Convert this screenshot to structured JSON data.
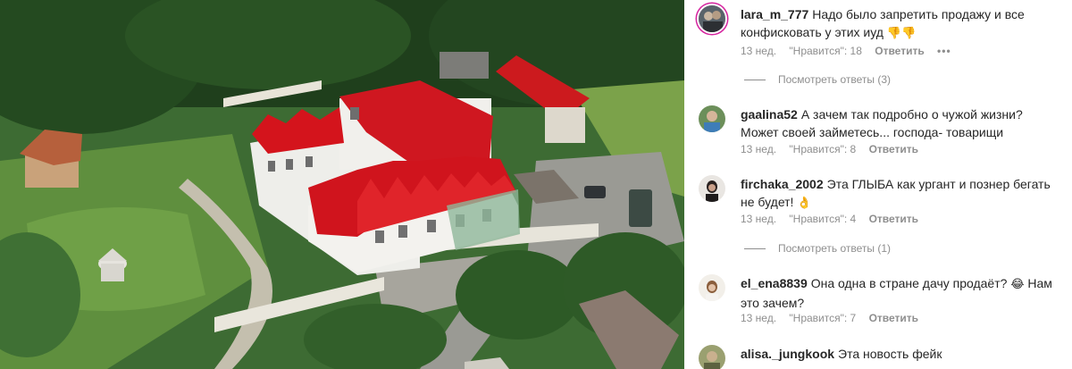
{
  "comments": [
    {
      "username": "lara_m_777",
      "text": "Надо было запретить продажу и все конфисковать у этих иуд",
      "emoji": "👎👎",
      "time": "13 нед.",
      "likes": "\"Нравится\": 18",
      "reply": "Ответить",
      "more": "•••",
      "view_replies": "Посмотреть ответы (3)",
      "avatar_icon": "user-avatar-icon"
    },
    {
      "username": "gaalina52",
      "text": "А зачем так подробно о чужой жизни? Может своей займетесь... господа- товарищи",
      "time": "13 нед.",
      "likes": "\"Нравится\": 8",
      "reply": "Ответить",
      "avatar_icon": "user-avatar-icon"
    },
    {
      "username": "firchaka_2002",
      "text": "Эта ГЛЫБА как ургант и познер бегать не будет!",
      "emoji": "👌",
      "time": "13 нед.",
      "likes": "\"Нравится\": 4",
      "reply": "Ответить",
      "view_replies": "Посмотреть ответы (1)",
      "avatar_icon": "user-avatar-icon"
    },
    {
      "username": "el_ena8839",
      "text": "Она одна в стране дачу продаёт?",
      "emoji": "😂",
      "text2": "Нам это зачем?",
      "time": "13 нед.",
      "likes": "\"Нравится\": 7",
      "reply": "Ответить",
      "avatar_icon": "user-avatar-icon"
    },
    {
      "username": "alisa._jungkook",
      "text": "Эта новость фейк",
      "avatar_icon": "user-avatar-icon"
    }
  ],
  "colors": {
    "text": "#262626",
    "secondary": "#8e8e8e",
    "story_ring": "#d6249f",
    "roof_red": "#d4141c",
    "foliage": "#2f5a2a"
  }
}
